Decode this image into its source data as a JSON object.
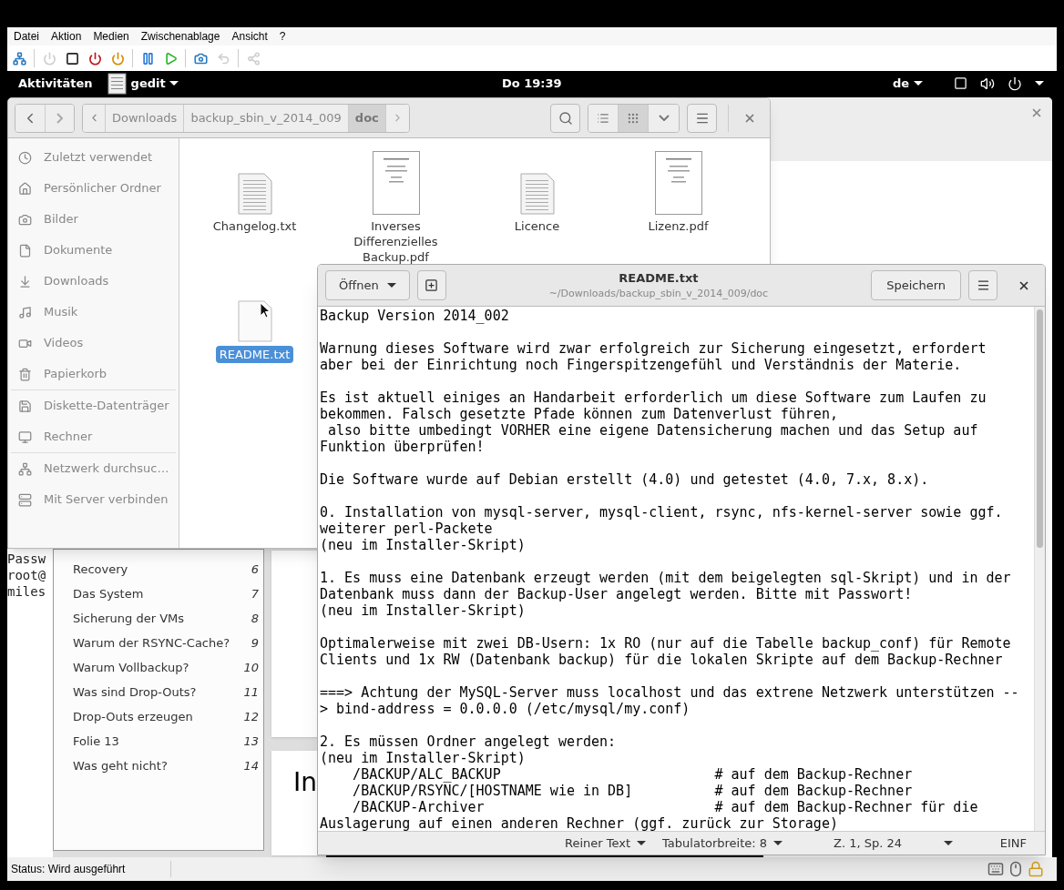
{
  "vm_menu": [
    {
      "label": "Datei"
    },
    {
      "label": "Aktion"
    },
    {
      "label": "Medien"
    },
    {
      "label": "Zwischenablage"
    },
    {
      "label": "Ansicht"
    },
    {
      "label": "?"
    }
  ],
  "vm_toolbar": [
    {
      "kind": "network",
      "disabled": false
    },
    {
      "kind": "sep"
    },
    {
      "kind": "power",
      "disabled": true
    },
    {
      "kind": "stop",
      "disabled": false
    },
    {
      "kind": "power_red",
      "disabled": false
    },
    {
      "kind": "power_orange",
      "disabled": false
    },
    {
      "kind": "sep"
    },
    {
      "kind": "pause",
      "disabled": false
    },
    {
      "kind": "play",
      "disabled": false
    },
    {
      "kind": "sep"
    },
    {
      "kind": "checkpoint",
      "disabled": false
    },
    {
      "kind": "revert",
      "disabled": true
    },
    {
      "kind": "sep"
    },
    {
      "kind": "share",
      "disabled": true
    }
  ],
  "top_bar": {
    "activities": "Aktivitäten",
    "app": "gedit",
    "clock": "Do 19:39",
    "keyboard": "de"
  },
  "terminal": {
    "lines": [
      "Passw",
      "root@",
      "miles"
    ]
  },
  "slide_panel": {
    "items": [
      {
        "title": "Recovery",
        "number": "6"
      },
      {
        "title": "Das System",
        "number": "7"
      },
      {
        "title": "Sicherung der VMs",
        "number": "8"
      },
      {
        "title": "Warum der RSYNC-Cache?",
        "number": "9"
      },
      {
        "title": "Warum Vollbackup?",
        "number": "10"
      },
      {
        "title": "Was sind Drop-Outs?",
        "number": "11"
      },
      {
        "title": "Drop-Outs erzeugen",
        "number": "12"
      },
      {
        "title": "Folie 13",
        "number": "13"
      },
      {
        "title": "Was geht nicht?",
        "number": "14"
      }
    ]
  },
  "slide_preview": {
    "title": "In"
  },
  "files": {
    "path": [
      {
        "label": "Downloads",
        "selected": false
      },
      {
        "label": "backup_sbin_v_2014_009",
        "selected": false
      },
      {
        "label": "doc",
        "selected": true
      }
    ],
    "view_modes": [
      {
        "kind": "list",
        "selected": false
      },
      {
        "kind": "grid",
        "selected": true
      }
    ],
    "sidebar": [
      [
        {
          "label": "Zuletzt verwendet",
          "kind": "recent"
        },
        {
          "label": "Persönlicher Ordner",
          "kind": "home"
        },
        {
          "label": "Bilder",
          "kind": "pictures"
        },
        {
          "label": "Dokumente",
          "kind": "documents"
        },
        {
          "label": "Downloads",
          "kind": "downloads"
        },
        {
          "label": "Musik",
          "kind": "music"
        },
        {
          "label": "Videos",
          "kind": "videos"
        },
        {
          "label": "Papierkorb",
          "kind": "trash"
        }
      ],
      [
        {
          "label": "Diskette-Datenträger",
          "kind": "floppy"
        },
        {
          "label": "Rechner",
          "kind": "computer"
        }
      ],
      [
        {
          "label": "Netzwerk durchsuc…",
          "kind": "network"
        },
        {
          "label": "Mit Server verbinden",
          "kind": "server"
        }
      ]
    ],
    "items": [
      {
        "name": "Changelog.txt",
        "kind": "text",
        "selected": false
      },
      {
        "name": "Inverses Differenzielles Backup.pdf",
        "kind": "pdf",
        "selected": false
      },
      {
        "name": "Licence",
        "kind": "text",
        "selected": false
      },
      {
        "name": "Lizenz.pdf",
        "kind": "pdf",
        "selected": false
      },
      {
        "name": "README.txt",
        "kind": "blank",
        "selected": true
      }
    ]
  },
  "editor": {
    "open": "Öffnen",
    "title": "README.txt",
    "subtitle": "~/Downloads/backup_sbin_v_2014_009/doc",
    "save": "Speichern",
    "paragraphs": [
      [
        "Backup Version 2014_002"
      ],
      [
        "Warnung dieses Software wird zwar erfolgreich zur Sicherung eingesetzt, erfordert",
        "aber bei der Einrichtung noch Fingerspitzengefühl und Verständnis der Materie."
      ],
      [
        "Es ist aktuell einiges an Handarbeit erforderlich um diese Software zum Laufen zu",
        "bekommen. Falsch gesetzte Pfade können zum Datenverlust führen,",
        " also bitte umbedingt VORHER eine eigene Datensicherung machen und das Setup auf",
        "Funktion überprüfen!"
      ],
      [
        "Die Software wurde auf Debian erstellt (4.0) und getestet (4.0, 7.x, 8.x)."
      ],
      [
        "0. Installation von mysql-server, mysql-client, rsync, nfs-kernel-server sowie ggf.",
        "weiterer perl-Packete",
        "(neu im Installer-Skript)"
      ],
      [
        "1. Es muss eine Datenbank erzeugt werden (mit dem beigelegten sql-Skript) und in der",
        "Datenbank muss dann der Backup-User angelegt werden. Bitte mit Passwort!",
        "(neu im Installer-Skript)"
      ],
      [
        "Optimalerweise mit zwei DB-Usern: 1x RO (nur auf die Tabelle backup_conf) für Remote",
        "Clients und 1x RW (Datenbank backup) für die lokalen Skripte auf dem Backup-Rechner"
      ],
      [
        "===> Achtung der MySQL-Server muss localhost und das extrene Netzwerk unterstützen --",
        "> bind-address = 0.0.0.0 (/etc/mysql/my.conf)"
      ],
      [
        "2. Es müssen Ordner angelegt werden:",
        "(neu im Installer-Skript)",
        "    /BACKUP/ALC_BACKUP                          # auf dem Backup-Rechner",
        "    /BACKUP/RSYNC/[HOSTNAME wie in DB]          # auf dem Backup-Rechner",
        "    /BACKUP-Archiver                            # auf dem Backup-Rechner für die",
        "Auslagerung auf einen anderen Rechner (ggf. zurück zur Storage)"
      ]
    ],
    "status": {
      "language": "Reiner Text",
      "tab_width": "Tabulatorbreite: 8",
      "position": "Z. 1, Sp. 24",
      "mode": "EINF"
    }
  },
  "vm_status": "Status: Wird ausgeführt"
}
